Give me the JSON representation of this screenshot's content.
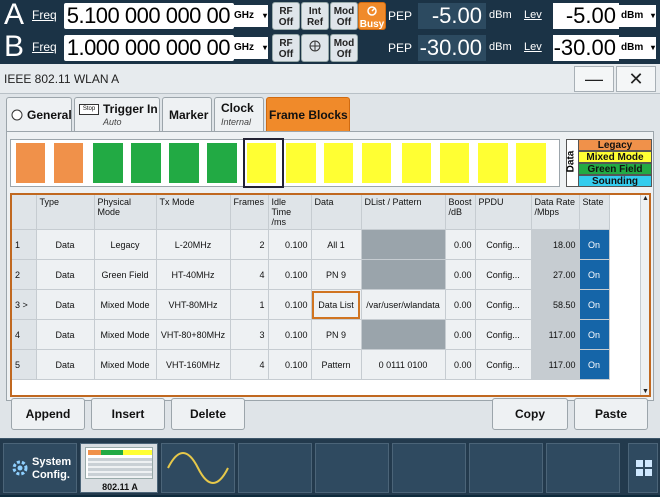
{
  "status": {
    "pathA": {
      "letter": "A",
      "freq_label": "Freq",
      "freq_value": "5.100 000 000 00",
      "freq_unit": "GHz",
      "rf": "RF\nOff",
      "ref": "Int\nRef",
      "mod": "Mod\nOff",
      "busy": "Busy",
      "pep_label": "PEP",
      "pep_value": "-5.00",
      "pep_unit": "dBm",
      "lev_label": "Lev",
      "lev_value": "-5.00",
      "lev_unit": "dBm"
    },
    "pathB": {
      "letter": "B",
      "freq_label": "Freq",
      "freq_value": "1.000 000 000 00",
      "freq_unit": "GHz",
      "rf": "RF\nOff",
      "mod": "Mod\nOff",
      "pep_label": "PEP",
      "pep_value": "-30.00",
      "pep_unit": "dBm",
      "lev_label": "Lev",
      "lev_value": "-30.00",
      "lev_unit": "dBm"
    }
  },
  "dialog": {
    "title": "IEEE 802.11 WLAN  A",
    "minimize": "—",
    "close": "✕",
    "tabs": [
      {
        "label": "General",
        "sub": ""
      },
      {
        "label": "Trigger In",
        "sub": "Auto",
        "icon_text": "Stop"
      },
      {
        "label": "Marker",
        "sub": ""
      },
      {
        "label": "Clock",
        "sub": "Internal"
      },
      {
        "label": "Frame Blocks",
        "sub": ""
      }
    ],
    "active_tab": "Frame Blocks"
  },
  "legend": {
    "title": "Data",
    "items": [
      {
        "label": "Legacy",
        "color": "#f0914a"
      },
      {
        "label": "Mixed Mode",
        "color": "#ffff33"
      },
      {
        "label": "Green Field",
        "color": "#22aa44"
      },
      {
        "label": "Sounding",
        "color": "#33ccee"
      }
    ]
  },
  "strip_blocks": [
    {
      "mode": "Legacy",
      "frames": 2
    },
    {
      "mode": "Green Field",
      "frames": 4
    },
    {
      "mode": "Mixed Mode",
      "frames": 1
    },
    {
      "mode": "Mixed Mode",
      "frames": 3
    },
    {
      "mode": "Mixed Mode",
      "frames": 4
    }
  ],
  "table": {
    "headers": [
      "",
      "Type",
      "Physical Mode",
      "Tx Mode",
      "Frames",
      "Idle Time /ms",
      "Data",
      "DList / Pattern",
      "Boost /dB",
      "PPDU",
      "Data Rate /Mbps",
      "State"
    ],
    "rows": [
      {
        "idx": "1",
        "type": "Data",
        "phys": "Legacy",
        "tx": "L-20MHz",
        "frames": "2",
        "idle": "0.100",
        "data": "All 1",
        "dlist": "",
        "boost": "0.00",
        "ppdu": "Config...",
        "rate": "18.00",
        "state": "On"
      },
      {
        "idx": "2",
        "type": "Data",
        "phys": "Green Field",
        "tx": "HT-40MHz",
        "frames": "4",
        "idle": "0.100",
        "data": "PN  9",
        "dlist": "",
        "boost": "0.00",
        "ppdu": "Config...",
        "rate": "27.00",
        "state": "On"
      },
      {
        "idx": "3 >",
        "type": "Data",
        "phys": "Mixed Mode",
        "tx": "VHT-80MHz",
        "frames": "1",
        "idle": "0.100",
        "data": "Data List",
        "dlist": "/var/user/wlandata",
        "boost": "0.00",
        "ppdu": "Config...",
        "rate": "58.50",
        "state": "On"
      },
      {
        "idx": "4",
        "type": "Data",
        "phys": "Mixed Mode",
        "tx": "VHT-80+80MHz",
        "frames": "3",
        "idle": "0.100",
        "data": "PN  9",
        "dlist": "",
        "boost": "0.00",
        "ppdu": "Config...",
        "rate": "117.00",
        "state": "On"
      },
      {
        "idx": "5",
        "type": "Data",
        "phys": "Mixed Mode",
        "tx": "VHT-160MHz",
        "frames": "4",
        "idle": "0.100",
        "data": "Pattern",
        "dlist": "0 0111 0100",
        "boost": "0.00",
        "ppdu": "Config...",
        "rate": "117.00",
        "state": "On"
      }
    ]
  },
  "buttons": {
    "append": "Append",
    "insert": "Insert",
    "delete": "Delete",
    "copy": "Copy",
    "paste": "Paste"
  },
  "taskbar": {
    "system_config": "System\nConfig.",
    "thumb_label": "802.11  A"
  }
}
